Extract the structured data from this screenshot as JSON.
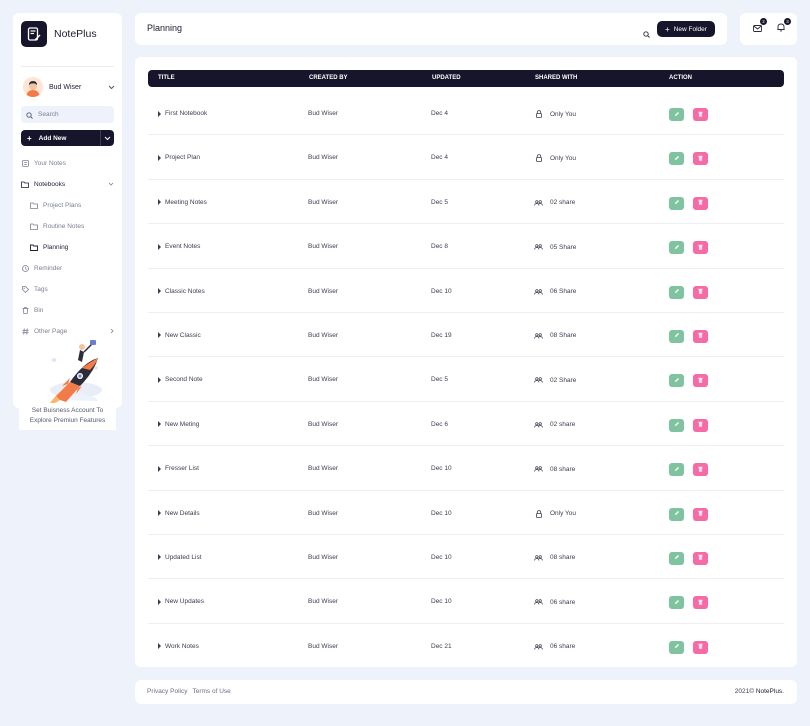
{
  "brand": {
    "name": "NotePlus"
  },
  "user": {
    "name": "Bud Wiser"
  },
  "sidebar": {
    "search_placeholder": "Search",
    "add_new_label": "Add New",
    "nav": [
      {
        "label": "Your Notes",
        "icon": "notes-icon"
      },
      {
        "label": "Notebooks",
        "icon": "folder-open-icon"
      },
      {
        "label": "Project Plans",
        "icon": "folder-icon"
      },
      {
        "label": "Routine Notes",
        "icon": "folder-icon"
      },
      {
        "label": "Planning",
        "icon": "folder-icon"
      },
      {
        "label": "Reminder",
        "icon": "clock-icon"
      },
      {
        "label": "Tags",
        "icon": "tag-icon"
      },
      {
        "label": "Bin",
        "icon": "trash-icon"
      },
      {
        "label": "Other Page",
        "icon": "hash-icon"
      }
    ],
    "promo_line1": "Set Buisness Account To",
    "promo_line2": "Explore Premiun Features"
  },
  "header": {
    "title": "Planning",
    "new_folder_label": "New Folder",
    "mail_count": "2",
    "bell_count": "3"
  },
  "table": {
    "columns": [
      "TITLE",
      "CREATED BY",
      "UPDATED",
      "SHARED WITH",
      "ACTION"
    ],
    "rows": [
      {
        "title": "First Notebook",
        "created_by": "Bud Wiser",
        "updated": "Dec 4",
        "shared": "Only You",
        "shared_icon": "lock-icon"
      },
      {
        "title": "Project Plan",
        "created_by": "Bud Wiser",
        "updated": "Dec 4",
        "shared": "Only You",
        "shared_icon": "lock-icon"
      },
      {
        "title": "Meeting Notes",
        "created_by": "Bud Wiser",
        "updated": "Dec 5",
        "shared": "02 share",
        "shared_icon": "users-icon"
      },
      {
        "title": "Event Notes",
        "created_by": "Bud Wiser",
        "updated": "Dec 8",
        "shared": "05 Share",
        "shared_icon": "users-icon"
      },
      {
        "title": "Classic Notes",
        "created_by": "Bud Wiser",
        "updated": "Dec 10",
        "shared": "06 Share",
        "shared_icon": "users-icon"
      },
      {
        "title": "New Classic",
        "created_by": "Bud Wiser",
        "updated": "Dec 19",
        "shared": "08 Share",
        "shared_icon": "users-icon"
      },
      {
        "title": "Second Note",
        "created_by": "Bud Wiser",
        "updated": "Dec 5",
        "shared": "02 Share",
        "shared_icon": "users-icon"
      },
      {
        "title": "New Meting",
        "created_by": "Bud Wiser",
        "updated": "Dec 6",
        "shared": "02 share",
        "shared_icon": "users-icon"
      },
      {
        "title": "Fresser List",
        "created_by": "Bud Wiser",
        "updated": "Dec 10",
        "shared": "08 share",
        "shared_icon": "users-icon"
      },
      {
        "title": "New Details",
        "created_by": "Bud Wiser",
        "updated": "Dec 10",
        "shared": "Only You",
        "shared_icon": "lock-icon"
      },
      {
        "title": "Updated List",
        "created_by": "Bud Wiser",
        "updated": "Dec 10",
        "shared": "08 share",
        "shared_icon": "users-icon"
      },
      {
        "title": "New Updates",
        "created_by": "Bud Wiser",
        "updated": "Dec 10",
        "shared": "06 share",
        "shared_icon": "users-icon"
      },
      {
        "title": "Work Notes",
        "created_by": "Bud Wiser",
        "updated": "Dec 21",
        "shared": "06 share",
        "shared_icon": "users-icon"
      }
    ]
  },
  "footer": {
    "privacy": "Privacy Policy",
    "terms": "Terms of Use",
    "copyright_prefix": "2021©",
    "copyright_brand": "NotePlus."
  },
  "colors": {
    "dark": "#16152b",
    "background": "#eef2fb",
    "edit": "#7fc3a1",
    "delete": "#f46ba5"
  }
}
